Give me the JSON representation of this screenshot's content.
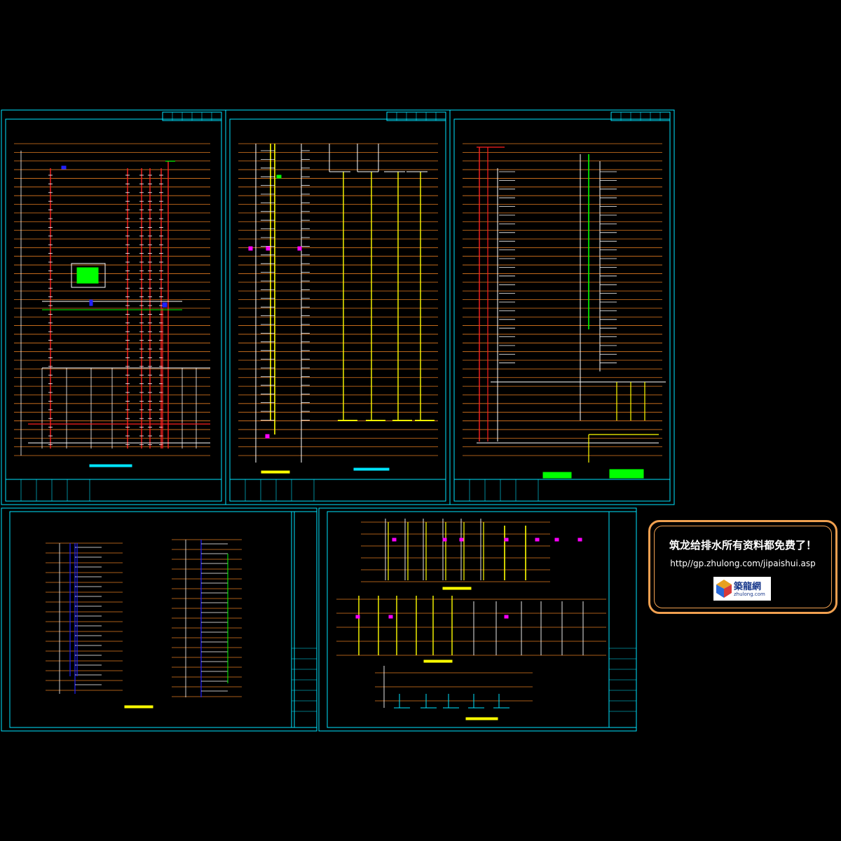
{
  "promo": {
    "title": "筑龙给排水所有资料都免费了！",
    "url": "http//gp.zhulong.com/jipaishui.asp",
    "logo_cn": "築龍網",
    "logo_en": "zhulong.com"
  },
  "colors": {
    "frame": "#00e5ff",
    "floor_line": "#e07a20",
    "pipe_red": "#ff2020",
    "pipe_yellow": "#ffff00",
    "pipe_green": "#00ff00",
    "pipe_blue": "#2020ff",
    "accent_magenta": "#ff00ff",
    "promo_border": "#f0a050"
  }
}
